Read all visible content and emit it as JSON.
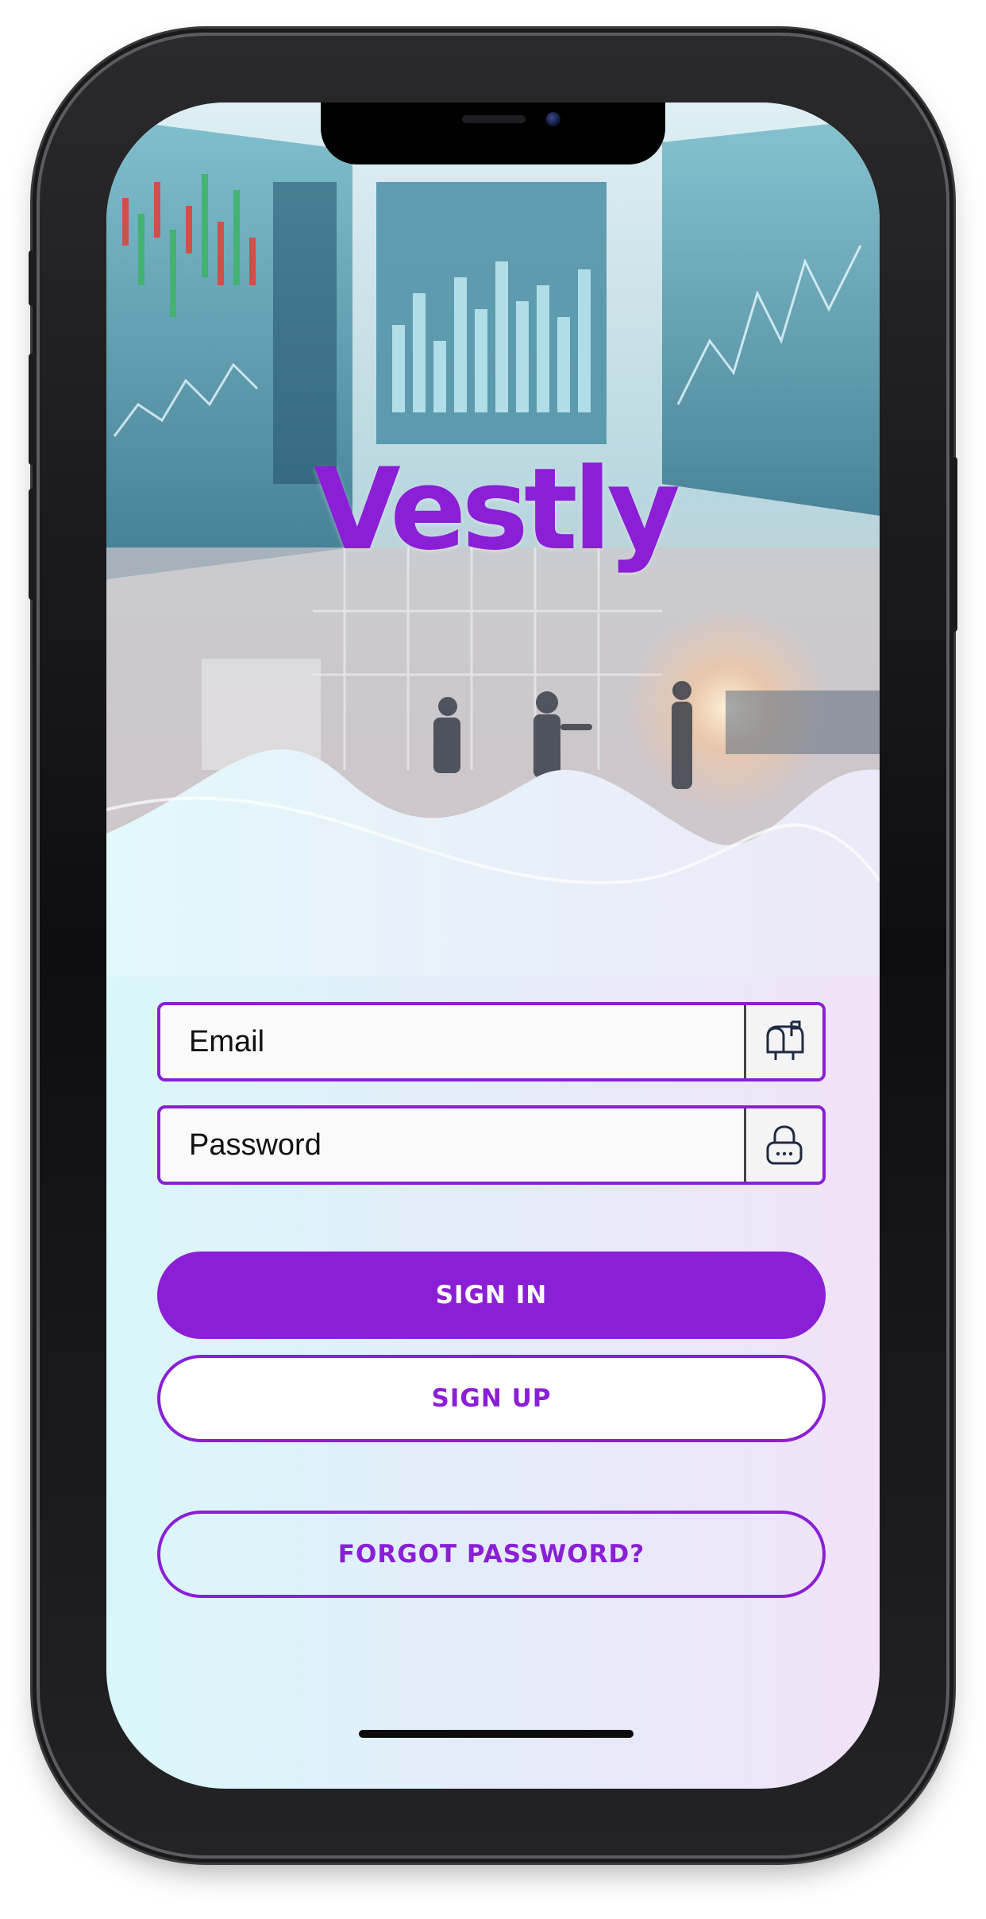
{
  "app": {
    "logo_text": "Vestly",
    "brand_color": "#8a1fd6"
  },
  "login_form": {
    "email": {
      "placeholder": "Email",
      "value": "",
      "icon": "mailbox-icon"
    },
    "password": {
      "placeholder": "Password",
      "value": "",
      "icon": "lock-icon"
    }
  },
  "actions": {
    "sign_in_label": "SIGN IN",
    "sign_up_label": "SIGN UP",
    "forgot_password_label": "FORGOT PASSWORD?"
  },
  "hero": {
    "image": "trading-floor-hero-image"
  }
}
